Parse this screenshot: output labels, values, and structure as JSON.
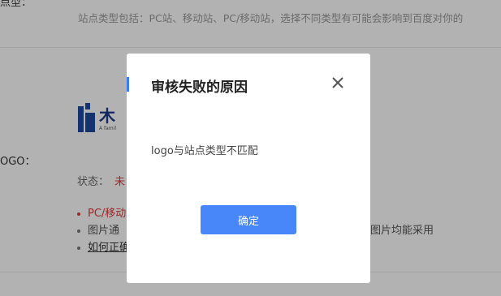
{
  "background": {
    "top_label": "点型：",
    "site_type_hint": "站点类型包括：PC站、移动站、PC/移动站，选择不同类型有可能会影响到百度对你的",
    "logo_label": "OGO：",
    "logo_brand": "木",
    "logo_tagline": "A famil",
    "status_label": "状态：",
    "status_value": "未",
    "bullets": [
      {
        "text": "PC/移动",
        "style": "red"
      },
      {
        "text": "图片通",
        "style": "normal"
      },
      {
        "text": "如何正确",
        "style": "link"
      }
    ],
    "bullet_suffix": "图片均能采用"
  },
  "modal": {
    "title": "审核失败的原因",
    "close_icon": "close-icon",
    "message": "logo与站点类型不匹配",
    "confirm_label": "确定"
  },
  "colors": {
    "accent": "#4787f9",
    "error": "#e03a3a",
    "overlay": "rgba(0,0,0,0.3)"
  }
}
